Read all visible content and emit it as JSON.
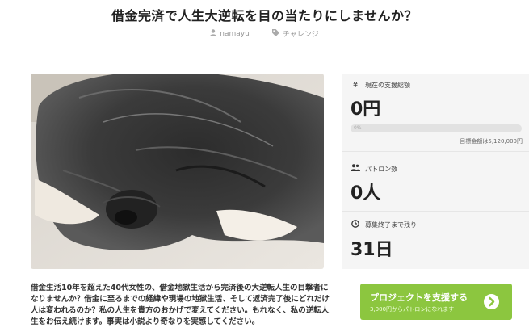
{
  "project": {
    "title": "借金完済で人生大逆転を目の当たりにしませんか？",
    "author": "namayu",
    "category": "チャレンジ"
  },
  "stats": {
    "funding": {
      "label": "現在の支援総額",
      "value": "0円",
      "icon": "yen-icon"
    },
    "progress": {
      "label": "0%",
      "fraction": 0.0
    },
    "goal_text": "目標金額は5,120,000円",
    "backers": {
      "label": "パトロン数",
      "value": "0人",
      "icon": "users-icon"
    },
    "remaining": {
      "label": "募集終了まで残り",
      "value": "31日",
      "icon": "clock-icon"
    }
  },
  "description": "借金生活10年を超えた40代女性の、借金地獄生活から完済後の大逆転人生の目撃者になりませんか？借金に至るまでの経緯や現場の地獄生活、そして返済完了後にどれだけ人は変われるのか？私の人生を貴方のおかげで変えてください。もれなく、私の逆転人生をお伝え続けます。事実は小説より奇なりを実感してください。",
  "cta": {
    "label": "プロジェクトを支援する",
    "sublabel": "3,000円からパトロンになれます",
    "color": "#8cc63f"
  },
  "icons": [
    "user-icon",
    "tag-icon",
    "yen-icon",
    "users-icon",
    "clock-icon",
    "chevron-right-icon"
  ]
}
